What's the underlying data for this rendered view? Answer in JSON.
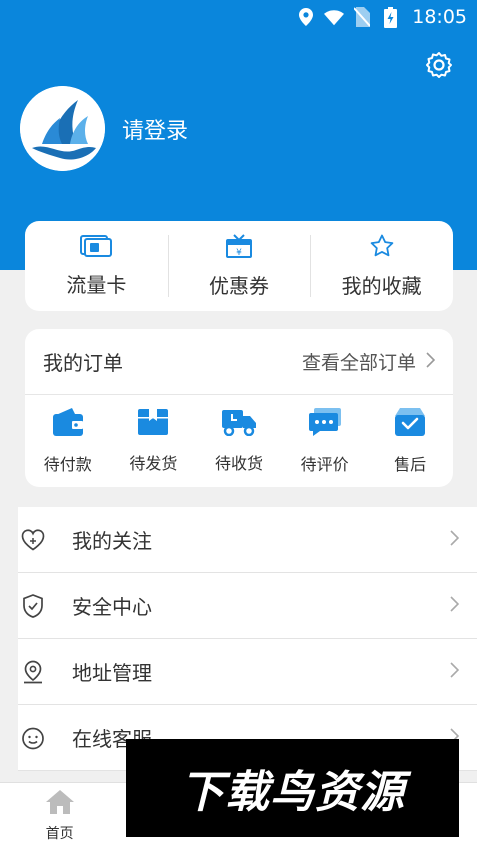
{
  "status_bar": {
    "time": "18:05",
    "icons": [
      "location-icon",
      "wifi-icon",
      "no-sim-icon",
      "battery-charging-icon"
    ]
  },
  "header": {
    "login_text": "请登录",
    "settings_icon": "gear-icon"
  },
  "quick_links": [
    {
      "label": "流量卡",
      "icon": "sim-card-icon"
    },
    {
      "label": "优惠券",
      "icon": "coupon-icon"
    },
    {
      "label": "我的收藏",
      "icon": "star-icon"
    }
  ],
  "orders": {
    "title": "我的订单",
    "view_all": "查看全部订单",
    "items": [
      {
        "label": "待付款",
        "icon": "wallet-icon"
      },
      {
        "label": "待发货",
        "icon": "box-icon"
      },
      {
        "label": "待收货",
        "icon": "truck-icon"
      },
      {
        "label": "待评价",
        "icon": "comment-icon"
      },
      {
        "label": "售后",
        "icon": "service-bag-icon"
      }
    ]
  },
  "menu": [
    {
      "label": "我的关注",
      "icon": "heart-icon"
    },
    {
      "label": "安全中心",
      "icon": "shield-icon"
    },
    {
      "label": "地址管理",
      "icon": "location-pin-icon"
    },
    {
      "label": "在线客服",
      "icon": "smile-icon"
    }
  ],
  "tabbar": {
    "tabs": [
      {
        "label": "首页",
        "icon": "home-icon"
      }
    ]
  },
  "watermark": {
    "text": "下载鸟资源"
  },
  "colors": {
    "brand": "#0a86dc",
    "icon_blue": "#1a8ae0"
  }
}
